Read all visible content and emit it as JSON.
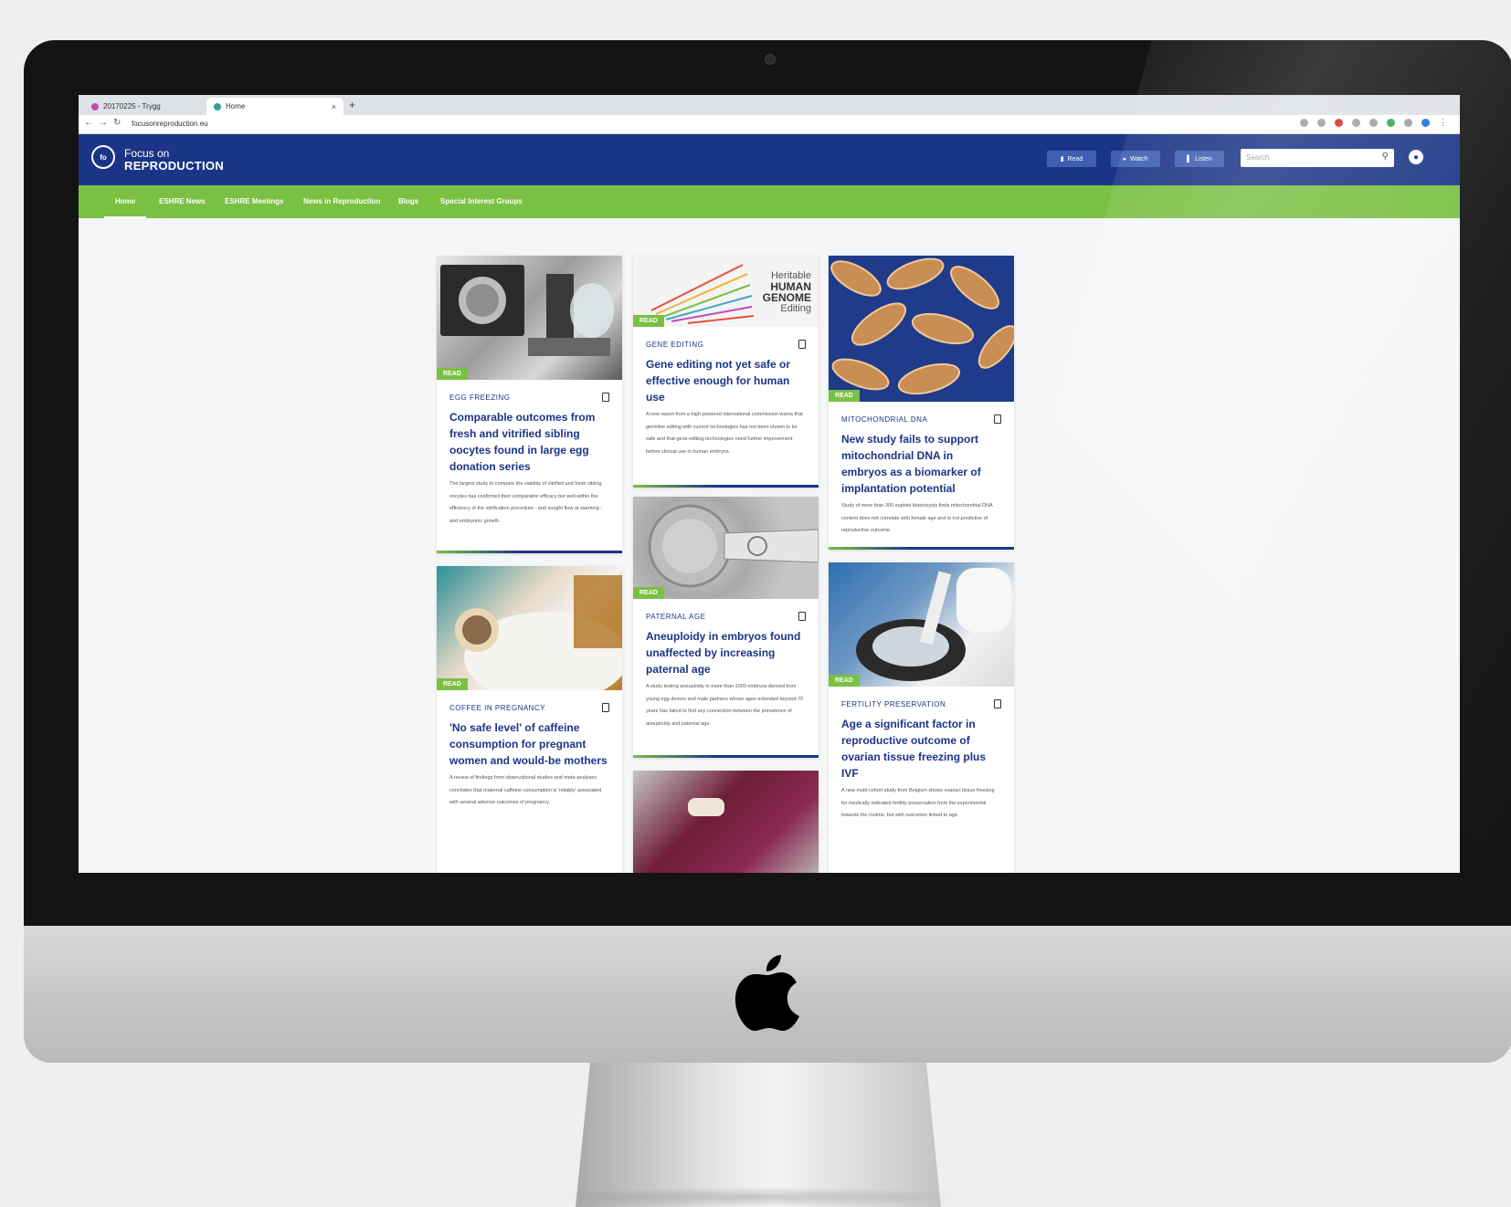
{
  "browser": {
    "tabs": [
      {
        "label": "20170225 - Trygg"
      },
      {
        "label": "Home"
      }
    ],
    "url": "focusonreproduction.eu"
  },
  "header": {
    "logo_badge": "fo",
    "logo_line1": "Focus on",
    "logo_line2": "REPRODUCTION",
    "buttons": {
      "read": "Read",
      "watch": "Watch",
      "listen": "Listen"
    },
    "search_placeholder": "Search"
  },
  "nav": {
    "items": [
      {
        "label": "Home"
      },
      {
        "label": "ESHRE News"
      },
      {
        "label": "ESHRE Meetings"
      },
      {
        "label": "News in Reproduction"
      },
      {
        "label": "Blogs"
      },
      {
        "label": "Special Interest Groups"
      }
    ]
  },
  "cards": [
    {
      "category": "EGG FREEZING",
      "title": "Comparable outcomes from fresh and vitrified sibling oocytes found in large egg donation series",
      "excerpt": "The largest study to compare the viability of vitrified and fresh sibling oocytes has confirmed their comparable efficacy but well within the efficiency of the vitrification procedure - and sought flow at warming - and embryonic growth.",
      "badge": "READ"
    },
    {
      "category": "GENE EDITING",
      "title": "Gene editing not yet safe or effective enough for human use",
      "excerpt": "A new report from a high-powered international commission warns that germline editing with current technologies has not been shown to be safe and that gene-editing technologies need further improvement before clinical use in human embryos.",
      "badge": "READ",
      "image_text": {
        "l1": "Heritable",
        "l2": "HUMAN",
        "l3": "GENOME",
        "l4": "Editing"
      }
    },
    {
      "category": "MITOCHONDRIAL DNA",
      "title": "New study fails to support mitochondrial DNA in embryos as a biomarker of implantation potential",
      "excerpt": "Study of more than 300 euploid blastocysts finds mitochondrial DNA content does not correlate with female age and is not predictive of reproductive outcome.",
      "badge": "READ"
    },
    {
      "category": "COFFEE IN PREGNANCY",
      "title": "'No safe level' of caffeine consumption for pregnant women and would-be mothers",
      "excerpt": "A review of findings from observational studies and meta-analyses concludes that maternal caffeine consumption is 'reliably' associated with several adverse outcomes of pregnancy.",
      "badge": "READ"
    },
    {
      "category": "PATERNAL AGE",
      "title": "Aneuploidy in embryos found unaffected by increasing paternal age",
      "excerpt": "A study testing aneuploidy in more than 1000 embryos derived from young egg donors and male partners whose ages extended beyond 70 years has failed to find any connection between the prevalence of aneuploidy and paternal age.",
      "badge": "READ"
    },
    {
      "category": "FERTILITY PRESERVATION",
      "title": "Age a significant factor in reproductive outcome of ovarian tissue freezing plus IVF",
      "excerpt": "A new multi-cohort study from Belgium shows ovarian tissue freezing for medically indicated fertility preservation from the experimental towards the routine, but with outcomes linked to age.",
      "badge": "READ"
    },
    {
      "badge": ""
    }
  ],
  "colors": {
    "brand_blue": "#1b3586",
    "brand_green": "#7ac043"
  }
}
